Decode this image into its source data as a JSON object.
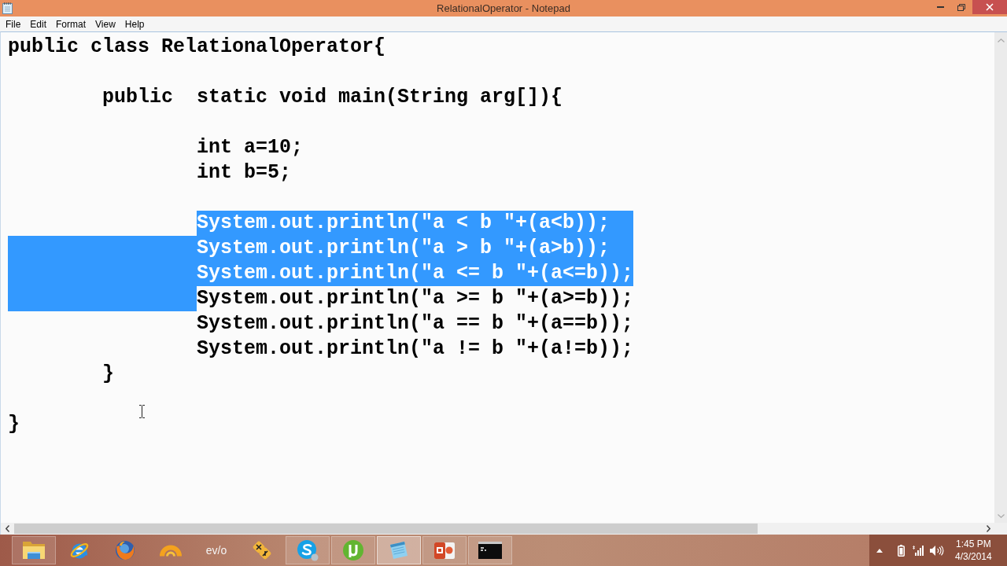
{
  "window": {
    "title": "RelationalOperator - Notepad"
  },
  "menu": [
    "File",
    "Edit",
    "Format",
    "View",
    "Help"
  ],
  "editor": {
    "lines": [
      {
        "kind": "code",
        "text": "public class RelationalOperator{",
        "selected": false,
        "children": [
          {
            "kind": "blank"
          },
          {
            "kind": "code",
            "text": "public\tstatic void main(String arg[]){",
            "selected": false,
            "indent_selected": false,
            "children": [
              {
                "kind": "blank"
              },
              {
                "kind": "code",
                "text": "int a=10;",
                "selected": false,
                "indent_selected": false
              },
              {
                "kind": "code",
                "text": "int b=5;",
                "selected": false,
                "indent_selected": false
              },
              {
                "kind": "blank"
              },
              {
                "kind": "code",
                "text": "System.out.println(\"a < b \"+(a<b));",
                "selected": true,
                "indent_selected": false
              },
              {
                "kind": "code",
                "text": "System.out.println(\"a > b \"+(a>b));",
                "selected": true,
                "indent_selected": true
              },
              {
                "kind": "code",
                "text": "System.out.println(\"a <= b \"+(a<=b));",
                "selected": true,
                "indent_selected": true
              },
              {
                "kind": "code",
                "text": "System.out.println(\"a >= b \"+(a>=b));",
                "selected": false,
                "indent_selected": true
              },
              {
                "kind": "code",
                "text": "System.out.println(\"a == b \"+(a==b));",
                "selected": false,
                "indent_selected": false
              },
              {
                "kind": "code",
                "text": "System.out.println(\"a != b \"+(a!=b));",
                "selected": false,
                "indent_selected": false
              }
            ]
          },
          {
            "kind": "code",
            "text": "}",
            "selected": false,
            "indent_selected": false
          },
          {
            "kind": "blank"
          }
        ]
      },
      {
        "kind": "code",
        "text": "}",
        "selected": false
      }
    ]
  },
  "taskbar": {
    "apps": [
      {
        "kind": "explorer",
        "running": true,
        "selected": false
      },
      {
        "kind": "ie",
        "running": false,
        "selected": false
      },
      {
        "kind": "firefox",
        "running": false,
        "selected": false
      },
      {
        "kind": "arch",
        "running": false,
        "selected": false
      },
      {
        "kind": "evo",
        "label": "ev/o",
        "running": false,
        "selected": false
      },
      {
        "kind": "tools",
        "running": false,
        "selected": false
      },
      {
        "kind": "skype",
        "running": true,
        "selected": false
      },
      {
        "kind": "utorrent",
        "running": true,
        "selected": false
      },
      {
        "kind": "notepad",
        "running": true,
        "selected": true
      },
      {
        "kind": "powerpoint",
        "running": true,
        "selected": false
      },
      {
        "kind": "console",
        "running": true,
        "selected": false
      }
    ],
    "clock": {
      "time": "1:45 PM",
      "date": "4/3/2014"
    }
  }
}
